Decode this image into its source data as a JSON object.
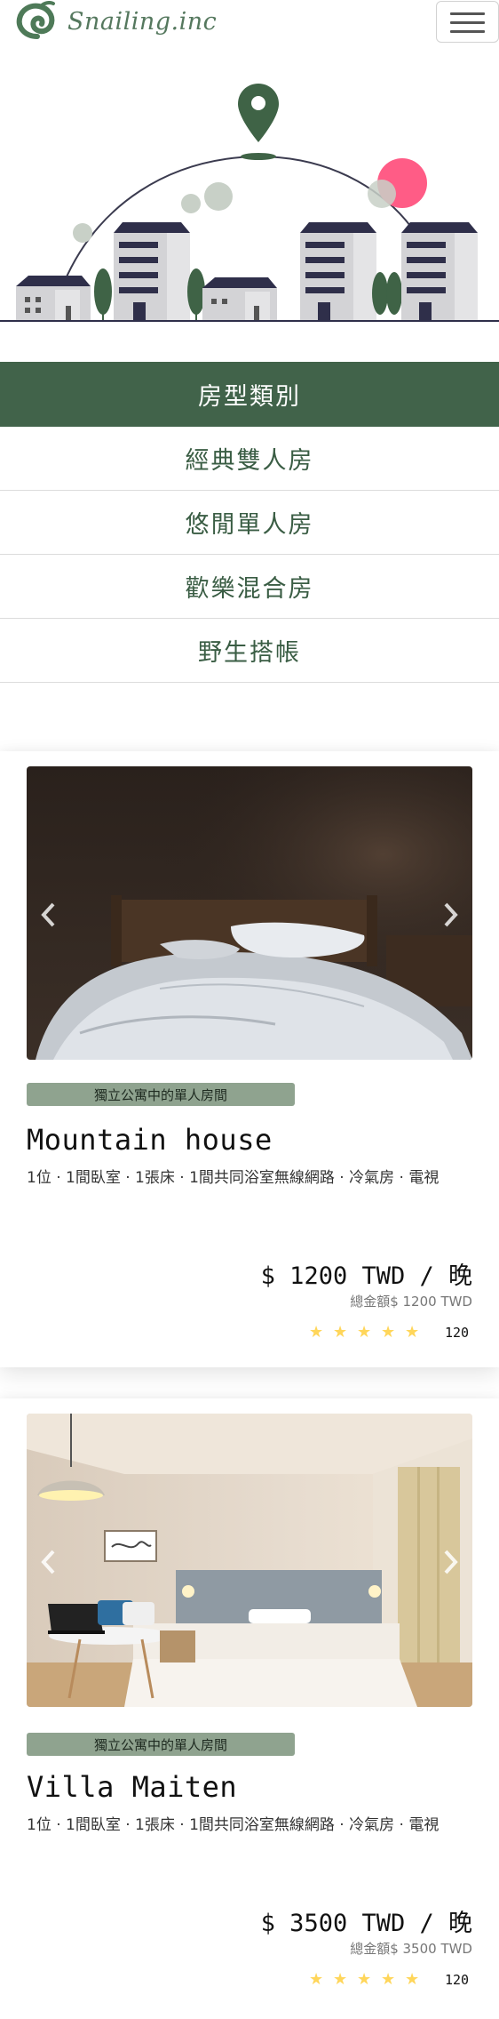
{
  "header": {
    "logo_text": "Snailing.inc",
    "menu_icon": "hamburger-icon"
  },
  "hero": {
    "illustration": "city-map-pin-illustration",
    "accent_color": "#ff5c86",
    "pin_color": "#3f6346"
  },
  "categories": {
    "header": "房型類別",
    "items": [
      "經典雙人房",
      "悠閒單人房",
      "歡樂混合房",
      "野生搭帳"
    ]
  },
  "rooms": [
    {
      "tag": "獨立公寓中的單人房間",
      "title": "Mountain house",
      "amenities": "1位 · 1間臥室 · 1張床 · 1間共同浴室無線網路 · 冷氣房 · 電視",
      "price": "$ 1200 TWD / 晚",
      "total": "總金額$ 1200 TWD",
      "rating": 5,
      "reviews": "120",
      "photo": "dark-bedroom-photo"
    },
    {
      "tag": "獨立公寓中的單人房間",
      "title": "Villa Maiten",
      "amenities": "1位 · 1間臥室 · 1張床 · 1間共同浴室無線網路 · 冷氣房 · 電視",
      "price": "$ 3500 TWD / 晚",
      "total": "總金額$ 3500 TWD",
      "rating": 5,
      "reviews": "120",
      "photo": "bright-bedroom-photo"
    }
  ],
  "colors": {
    "brand_green": "#41634a",
    "tag_bg": "#8fa38f",
    "star": "#ffd65a"
  }
}
